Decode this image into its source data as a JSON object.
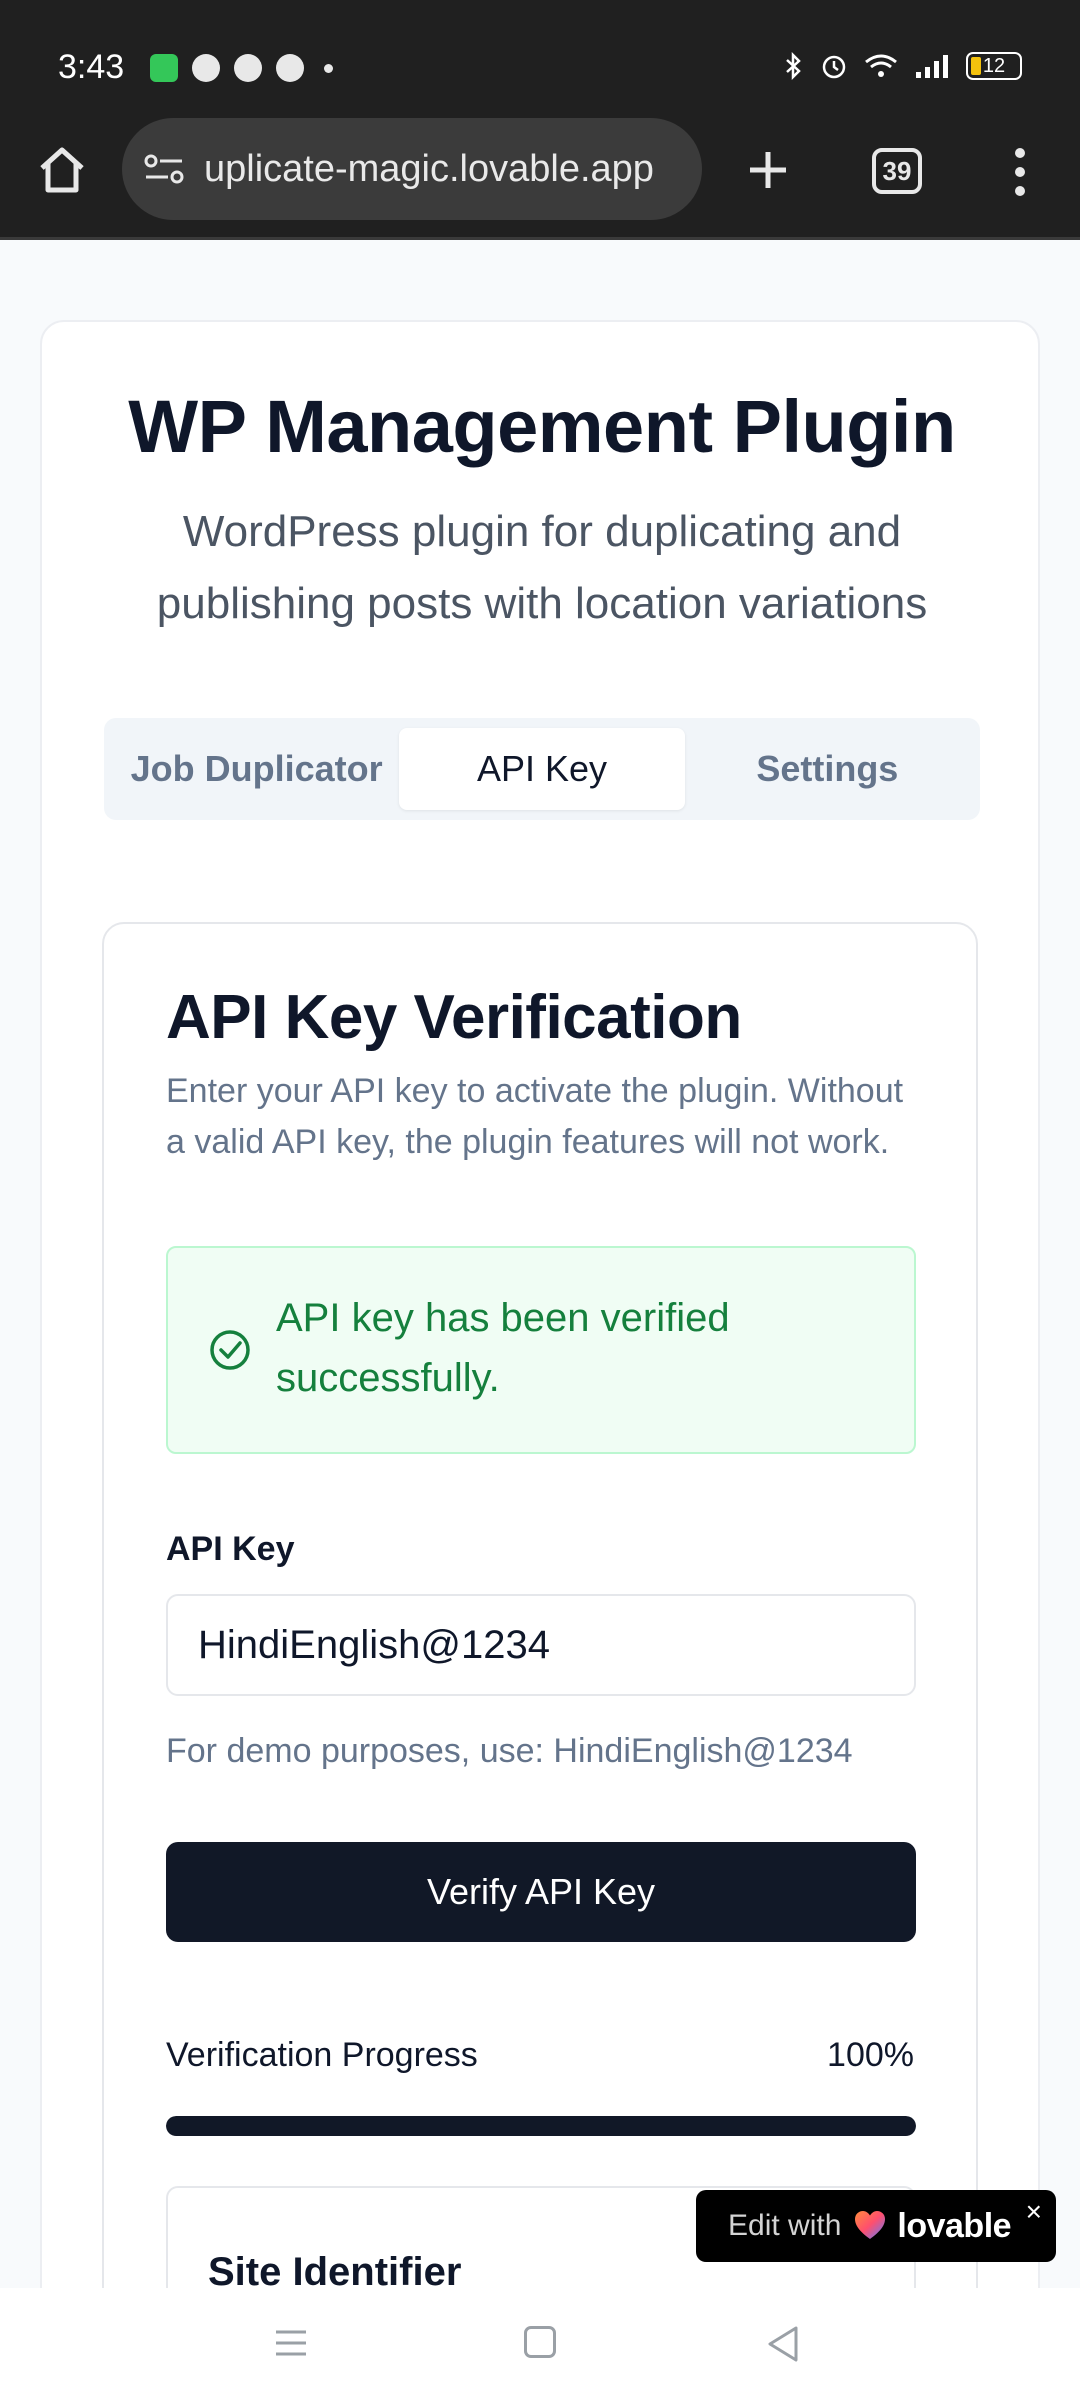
{
  "status_bar": {
    "time": "3:43",
    "battery": "12"
  },
  "browser": {
    "url": "uplicate-magic.lovable.app",
    "tab_count": "39"
  },
  "page": {
    "title": "WP Management Plugin",
    "subtitle": "WordPress plugin for duplicating and publishing posts with location variations",
    "tabs": [
      {
        "label": "Job Duplicator",
        "active": false
      },
      {
        "label": "API Key",
        "active": true
      },
      {
        "label": "Settings",
        "active": false
      }
    ]
  },
  "panel": {
    "title": "API Key Verification",
    "description": "Enter your API key to activate the plugin. Without a valid API key, the plugin features will not work.",
    "alert": "API key has been verified successfully.",
    "field_label": "API Key",
    "field_value": "HindiEnglish@1234",
    "hint": "For demo purposes, use: HindiEnglish@1234",
    "button_label": "Verify API Key",
    "progress_label": "Verification Progress",
    "progress_value": "100%",
    "progress_fraction": 1.0,
    "site_title": "Site Identifier"
  },
  "badge": {
    "edit_label": "Edit with",
    "brand": "lovable",
    "close": "×"
  },
  "colors": {
    "primary": "#111827",
    "success_bg": "#f0fdf4",
    "success_text": "#15803d",
    "muted": "#64748b"
  }
}
